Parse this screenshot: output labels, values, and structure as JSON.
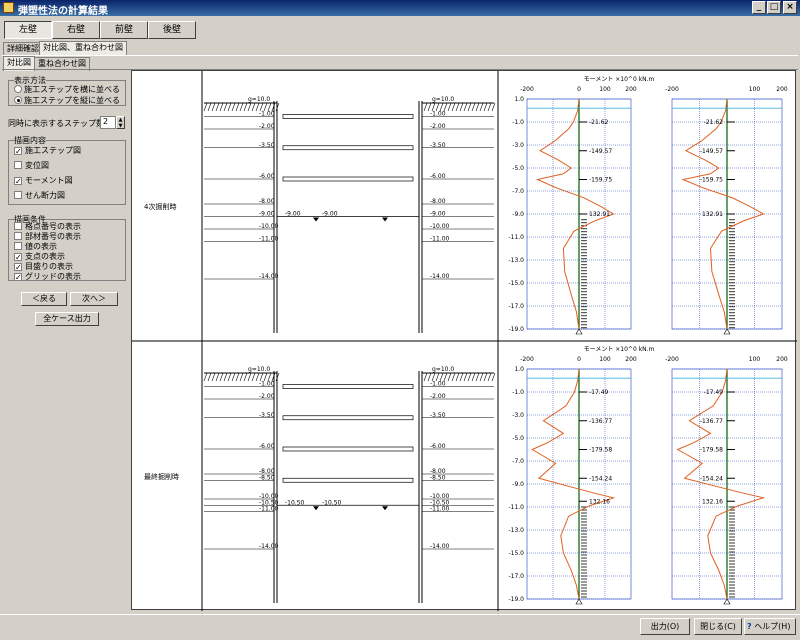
{
  "window": {
    "title": "弾塑性法の計算結果"
  },
  "wall_tabs": [
    "左壁",
    "右壁",
    "前壁",
    "後壁"
  ],
  "view_tabs": [
    "詳細確認",
    "対比図、重ね合わせ図"
  ],
  "sub_tabs": [
    "対比図",
    "重ね合わせ図"
  ],
  "display_method": {
    "label": "表示方法",
    "options": [
      "施工ステップを横に並べる",
      "施工ステップを縦に並べる"
    ],
    "selected": 1
  },
  "steps": {
    "label": "同時に表示するステップ数",
    "value": "2"
  },
  "draw_content": {
    "label": "描画内容",
    "items": [
      {
        "label": "施工ステップ図",
        "checked": true
      },
      {
        "label": "変位図",
        "checked": false
      },
      {
        "label": "モーメント図",
        "checked": true
      },
      {
        "label": "せん断力図",
        "checked": false
      }
    ]
  },
  "draw_conditions": {
    "label": "描画条件",
    "items": [
      {
        "label": "格点番号の表示",
        "checked": false
      },
      {
        "label": "部材番号の表示",
        "checked": false
      },
      {
        "label": "値の表示",
        "checked": false
      },
      {
        "label": "支点の表示",
        "checked": true
      },
      {
        "label": "目盛りの表示",
        "checked": true
      },
      {
        "label": "グリッドの表示",
        "checked": true
      }
    ]
  },
  "buttons": {
    "prev": "＜戻る",
    "next": "次へ＞",
    "all_output": "全ケース出力",
    "output": "出力(O)",
    "close": "閉じる(C)",
    "help": "ヘルプ(H)"
  },
  "cases": [
    {
      "label": "4次掘削時",
      "gl_label": "0.00",
      "top_label": "g=10.0",
      "wall_depths": [
        "-1.00",
        "-2.00",
        "-3.50",
        "-6.00",
        "-8.00",
        "-9.00",
        "-10.00",
        "-11.00",
        "-14.00"
      ],
      "struts": [
        "-1.00",
        "-3.50",
        "-6.00"
      ],
      "excavation": "-9.00",
      "chart_data": {
        "type": "line",
        "title": "モーメント ×10^0 kN.m",
        "xlim": [
          -200,
          200
        ],
        "ylim": [
          1.0,
          -19.0
        ],
        "x_ticks": [
          "-200",
          "0",
          "100",
          "200"
        ],
        "y_ticks": [
          "1.0",
          "-1.0",
          "-3.0",
          "-5.0",
          "-7.0",
          "-9.0",
          "-11.0",
          "-13.0",
          "-15.0",
          "-17.0",
          "-19.0"
        ],
        "annotations": [
          "-21.62",
          "-149.57",
          "-159.75",
          "132.91"
        ],
        "series": [
          {
            "x": [
              0,
              -5,
              -15,
              -21.62,
              -40,
              -90,
              -149.57,
              -80,
              -30,
              -60,
              -159.75,
              -90,
              20,
              80,
              132.91,
              60,
              -20,
              -60,
              -55,
              -30,
              -10,
              0
            ],
            "y": [
              1.0,
              0.0,
              -0.6,
              -1.0,
              -1.6,
              -2.6,
              -3.5,
              -4.3,
              -5.0,
              -5.5,
              -6.0,
              -6.7,
              -7.6,
              -8.3,
              -9.0,
              -9.6,
              -10.5,
              -12.0,
              -14.0,
              -16.0,
              -17.5,
              -19.0
            ]
          }
        ]
      }
    },
    {
      "label": "最終掘削時",
      "gl_label": "0.00",
      "top_label": "g=10.0",
      "wall_depths": [
        "-1.00",
        "-2.00",
        "-3.50",
        "-6.00",
        "-8.00",
        "-8.50",
        "-10.00",
        "-10.50",
        "-11.00",
        "-14.00"
      ],
      "struts": [
        "-1.00",
        "-3.50",
        "-6.00",
        "-8.50"
      ],
      "excavation": "-10.50",
      "chart_data": {
        "type": "line",
        "title": "モーメント ×10^0 kN.m",
        "xlim": [
          -200,
          200
        ],
        "ylim": [
          1.0,
          -19.0
        ],
        "x_ticks": [
          "-200",
          "0",
          "100",
          "200"
        ],
        "y_ticks": [
          "1.0",
          "-1.0",
          "-3.0",
          "-5.0",
          "-7.0",
          "-9.0",
          "-11.0",
          "-13.0",
          "-15.0",
          "-17.0",
          "-19.0"
        ],
        "annotations": [
          "-17.49",
          "-136.77",
          "-179.58",
          "-154.24",
          "132.16"
        ],
        "series": [
          {
            "x": [
              0,
              -5,
              -17.49,
              -50,
              -136.77,
              -60,
              -120,
              -179.58,
              -90,
              -154.24,
              -40,
              60,
              132.16,
              40,
              -40,
              -70,
              -60,
              -30,
              -10,
              0
            ],
            "y": [
              1.0,
              0.0,
              -1.0,
              -2.2,
              -3.5,
              -4.6,
              -5.4,
              -6.0,
              -7.2,
              -8.5,
              -9.2,
              -9.8,
              -10.2,
              -10.9,
              -11.8,
              -13.5,
              -15.0,
              -16.5,
              -17.8,
              -19.0
            ]
          }
        ]
      }
    }
  ]
}
